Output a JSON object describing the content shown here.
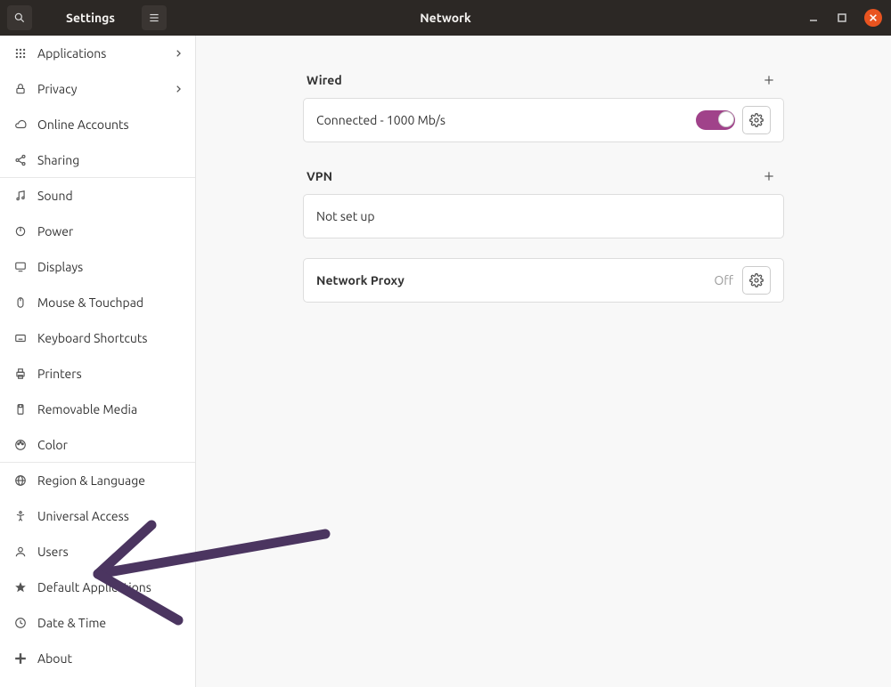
{
  "titlebar": {
    "left_title": "Settings",
    "center_title": "Network"
  },
  "sidebar": {
    "items": [
      {
        "id": "applications",
        "label": "Applications",
        "chevron": true
      },
      {
        "id": "privacy",
        "label": "Privacy",
        "chevron": true
      },
      {
        "id": "online-accounts",
        "label": "Online Accounts"
      },
      {
        "id": "sharing",
        "label": "Sharing",
        "group_end": true
      },
      {
        "id": "sound",
        "label": "Sound"
      },
      {
        "id": "power",
        "label": "Power"
      },
      {
        "id": "displays",
        "label": "Displays"
      },
      {
        "id": "mouse-touchpad",
        "label": "Mouse & Touchpad"
      },
      {
        "id": "keyboard-shortcuts",
        "label": "Keyboard Shortcuts"
      },
      {
        "id": "printers",
        "label": "Printers"
      },
      {
        "id": "removable-media",
        "label": "Removable Media"
      },
      {
        "id": "color",
        "label": "Color",
        "group_end": true
      },
      {
        "id": "region-language",
        "label": "Region & Language"
      },
      {
        "id": "universal-access",
        "label": "Universal Access"
      },
      {
        "id": "users",
        "label": "Users"
      },
      {
        "id": "default-applications",
        "label": "Default Applications"
      },
      {
        "id": "date-time",
        "label": "Date & Time"
      },
      {
        "id": "about",
        "label": "About"
      }
    ]
  },
  "sections": {
    "wired": {
      "title": "Wired",
      "status": "Connected - 1000 Mb/s",
      "switch_on": true
    },
    "vpn": {
      "title": "VPN",
      "status": "Not set up"
    },
    "proxy": {
      "title": "Network Proxy",
      "value": "Off"
    }
  },
  "annotation": {
    "arrow_points_to": "sidebar-item-users",
    "color": "#4b3560"
  }
}
